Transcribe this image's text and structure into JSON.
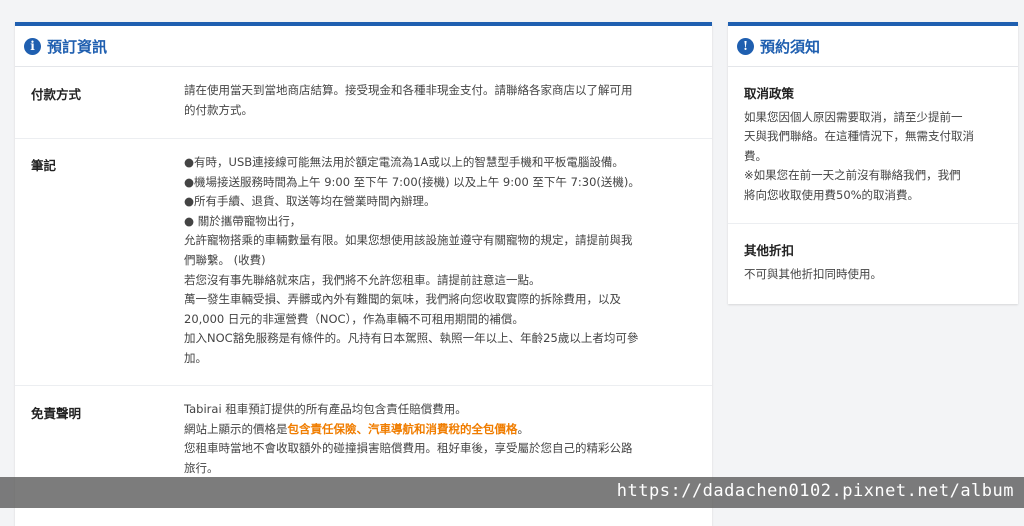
{
  "booking_info": {
    "title": "預訂資訊",
    "payment": {
      "label": "付款方式",
      "lines": [
        "請在使用當天到當地商店結算。接受現金和各種非現金支付。請聯絡各家商店以了解可用",
        "的付款方式。"
      ]
    },
    "notes": {
      "label": "筆記",
      "lines": [
        "●有時，USB連接線可能無法用於額定電流為1A或以上的智慧型手機和平板電腦設備。",
        "●機場接送服務時間為上午 9:00 至下午 7:00(接機) 以及上午 9:00 至下午 7:30(送機)。",
        "●所有手續、退貨、取送等均在營業時間內辦理。",
        "● 關於攜帶寵物出行，",
        "允許寵物搭乘的車輛數量有限。如果您想使用該設施並遵守有關寵物的規定，請提前與我",
        "們聯繫。 (收費)",
        "若您沒有事先聯絡就來店，我們將不允許您租車。請提前註意這一點。",
        "萬一發生車輛受損、弄髒或內外有難聞的氣味，我們將向您收取實際的拆除費用，以及",
        "20,000 日元的非運營費（NOC），作為車輛不可租用期間的補償。",
        "加入NOC豁免服務是有條件的。凡持有日本駕照、執照一年以上、年齡25歲以上者均可參",
        "加。"
      ]
    },
    "disclaimer": {
      "label": "免責聲明",
      "line1": "Tabirai 租車預訂提供的所有產品均包含責任賠償費用。",
      "line2_prefix": "網站上顯示的價格是",
      "line2_highlight": "包含責任保險、汽車導航和消費稅的全包價格",
      "line2_suffix": "。",
      "line3": "您租車時當地不會收取額外的碰撞損害賠償費用。租好車後，享受屬於您自己的精彩公路",
      "line4": "旅行。"
    }
  },
  "booking_notice": {
    "title": "預約須知",
    "cancellation": {
      "label": "取消政策",
      "lines": [
        "如果您因個人原因需要取消，請至少提前一",
        "天與我們聯絡。在這種情況下，無需支付取消",
        "費。",
        "※如果您在前一天之前沒有聯絡我們，我們",
        "將向您收取使用費50%的取消費。"
      ]
    },
    "discount": {
      "label": "其他折扣",
      "text": "不可與其他折扣同時使用。"
    }
  },
  "watermark": "https://dadachen0102.pixnet.net/album",
  "colors": {
    "accent": "#1f5fb0",
    "highlight": "#f07d00"
  }
}
